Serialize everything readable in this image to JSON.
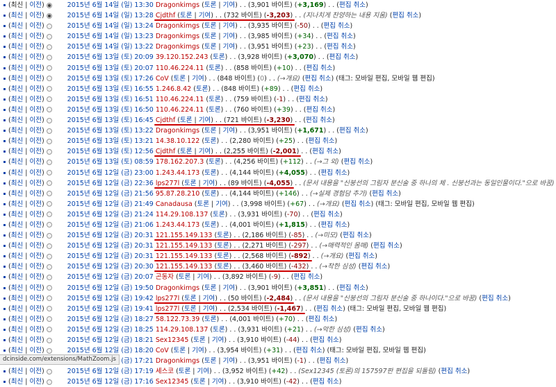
{
  "labels": {
    "cur": "최신",
    "sep": " | ",
    "prev": "이전",
    "talk": "토론",
    "contribs": "기여",
    "bytes_suffix": " 바이트",
    "undo": "편집 취소"
  },
  "rows": [
    {
      "date": "2015년 6월 14일 (일) 13:30",
      "user": "Dragonkimgs",
      "tl": true,
      "size": "3,901",
      "diff": "+3,169",
      "dc": "posbold",
      "summary": "",
      "tags": "",
      "cur_link": false,
      "prev_link": true,
      "radio": "checked",
      "underline": false
    },
    {
      "date": "2015년 6월 14일 (일) 13:28",
      "user": "Cjdthf",
      "tl": true,
      "size": "732",
      "diff": "-3,203",
      "dc": "negbold",
      "summary": "(지나치게 찬양하는 내용 지움)",
      "tags": "",
      "cur_link": true,
      "prev_link": true,
      "radio": "checked",
      "underline": true
    },
    {
      "date": "2015년 6월 14일 (일) 13:24",
      "user": "Dragonkimgs",
      "tl": true,
      "size": "3,935",
      "diff": "-50",
      "dc": "neg",
      "summary": "",
      "tags": "",
      "cur_link": true,
      "prev_link": true,
      "radio": "",
      "underline": false
    },
    {
      "date": "2015년 6월 14일 (일) 13:23",
      "user": "Dragonkimgs",
      "tl": true,
      "size": "3,985",
      "diff": "+34",
      "dc": "pos",
      "summary": "",
      "tags": "",
      "cur_link": true,
      "prev_link": true,
      "radio": "",
      "underline": false
    },
    {
      "date": "2015년 6월 14일 (일) 13:22",
      "user": "Dragonkimgs",
      "tl": true,
      "size": "3,951",
      "diff": "+23",
      "dc": "pos",
      "summary": "",
      "tags": "",
      "cur_link": true,
      "prev_link": true,
      "radio": "",
      "underline": false
    },
    {
      "date": "2015년 6월 13일 (토) 20:09",
      "user": "39.120.152.243",
      "tl": false,
      "size": "3,928",
      "diff": "+3,070",
      "dc": "posbold",
      "summary": "",
      "tags": "",
      "cur_link": true,
      "prev_link": true,
      "radio": "",
      "underline": false
    },
    {
      "date": "2015년 6월 13일 (토) 20:07",
      "user": "110.46.224.11",
      "tl": false,
      "size": "858",
      "diff": "+10",
      "dc": "pos",
      "summary": "",
      "tags": "",
      "cur_link": true,
      "prev_link": true,
      "radio": "",
      "underline": false
    },
    {
      "date": "2015년 6월 13일 (토) 17:26",
      "user": "CoV",
      "tl": true,
      "size": "848",
      "diff": "0",
      "dc": "zero",
      "summary": "(→개요)",
      "tags": "(태그: 모바일 편집, 모바일 웹 편집)",
      "cur_link": true,
      "prev_link": true,
      "radio": "",
      "underline": false
    },
    {
      "date": "2015년 6월 13일 (토) 16:55",
      "user": "1.246.8.42",
      "tl": false,
      "size": "848",
      "diff": "+89",
      "dc": "pos",
      "summary": "",
      "tags": "",
      "cur_link": true,
      "prev_link": true,
      "radio": "",
      "underline": false
    },
    {
      "date": "2015년 6월 13일 (토) 16:51",
      "user": "110.46.224.11",
      "tl": false,
      "size": "759",
      "diff": "-1",
      "dc": "neg",
      "summary": "",
      "tags": "",
      "cur_link": true,
      "prev_link": true,
      "radio": "",
      "underline": false
    },
    {
      "date": "2015년 6월 13일 (토) 16:50",
      "user": "110.46.224.11",
      "tl": false,
      "size": "760",
      "diff": "+39",
      "dc": "pos",
      "summary": "",
      "tags": "",
      "cur_link": true,
      "prev_link": true,
      "radio": "",
      "underline": false
    },
    {
      "date": "2015년 6월 13일 (토) 16:45",
      "user": "Cjdthf",
      "tl": true,
      "size": "721",
      "diff": "-3,230",
      "dc": "negbold",
      "summary": "",
      "tags": "",
      "cur_link": true,
      "prev_link": true,
      "radio": "",
      "underline": true
    },
    {
      "date": "2015년 6월 13일 (토) 13:22",
      "user": "Dragonkimgs",
      "tl": true,
      "size": "3,951",
      "diff": "+1,671",
      "dc": "posbold",
      "summary": "",
      "tags": "",
      "cur_link": true,
      "prev_link": true,
      "radio": "",
      "underline": false
    },
    {
      "date": "2015년 6월 13일 (토) 13:21",
      "user": "14.38.10.122",
      "tl": false,
      "size": "2,280",
      "diff": "+25",
      "dc": "pos",
      "summary": "",
      "tags": "",
      "cur_link": true,
      "prev_link": true,
      "radio": "",
      "underline": false
    },
    {
      "date": "2015년 6월 13일 (토) 12:56",
      "user": "Cjdthf",
      "tl": true,
      "size": "2,255",
      "diff": "-2,001",
      "dc": "negbold",
      "summary": "",
      "tags": "",
      "cur_link": true,
      "prev_link": true,
      "radio": "",
      "underline": true
    },
    {
      "date": "2015년 6월 13일 (토) 08:59",
      "user": "178.162.207.3",
      "tl": false,
      "size": "4,256",
      "diff": "+112",
      "dc": "pos",
      "summary": "(→그 외)",
      "tags": "",
      "cur_link": true,
      "prev_link": true,
      "radio": "",
      "underline": false
    },
    {
      "date": "2015년 6월 12일 (금) 23:00",
      "user": "1.243.44.173",
      "tl": false,
      "size": "4,144",
      "diff": "+4,055",
      "dc": "posbold",
      "summary": "",
      "tags": "",
      "cur_link": true,
      "prev_link": true,
      "radio": "",
      "underline": false
    },
    {
      "date": "2015년 6월 12일 (금) 22:36",
      "user": "lps277l",
      "tl": true,
      "size": "89",
      "diff": "-4,055",
      "dc": "negbold",
      "summary": "(문서 내용을 \"신붕선의 그림자 분신술 중 하나의 체 . 신붕선과는 동일인물이다.\"으로 바꿈)",
      "tags": "",
      "cur_link": true,
      "prev_link": true,
      "radio": "",
      "underline": true
    },
    {
      "date": "2015년 6월 12일 (금) 21:56",
      "user": "95.87.28.210",
      "tl": false,
      "size": "4,144",
      "diff": "+146",
      "dc": "pos",
      "summary": "(→실제 경험담 추가)",
      "tags": "",
      "cur_link": true,
      "prev_link": true,
      "radio": "",
      "underline": false
    },
    {
      "date": "2015년 6월 12일 (금) 21:49",
      "user": "Canadausa",
      "tl": true,
      "size": "3,998",
      "diff": "+67",
      "dc": "pos",
      "summary": "(→개요)",
      "tags": "(태그: 모바일 편집, 모바일 웹 편집)",
      "cur_link": true,
      "prev_link": true,
      "radio": "",
      "underline": false
    },
    {
      "date": "2015년 6월 12일 (금) 21:24",
      "user": "114.29.108.137",
      "tl": false,
      "size": "3,931",
      "diff": "-70",
      "dc": "neg",
      "summary": "",
      "tags": "",
      "cur_link": true,
      "prev_link": true,
      "radio": "",
      "underline": false
    },
    {
      "date": "2015년 6월 12일 (금) 21:06",
      "user": "1.243.44.173",
      "tl": false,
      "size": "4,001",
      "diff": "+1,815",
      "dc": "posbold",
      "summary": "",
      "tags": "",
      "cur_link": true,
      "prev_link": true,
      "radio": "",
      "underline": false
    },
    {
      "date": "2015년 6월 12일 (금) 20:31",
      "user": "121.155.149.133",
      "tl": false,
      "talk_only": true,
      "size": "2,186",
      "diff": "-85",
      "dc": "neg",
      "summary": "(→미모)",
      "tags": "",
      "cur_link": true,
      "prev_link": true,
      "radio": "",
      "underline": true
    },
    {
      "date": "2015년 6월 12일 (금) 20:31",
      "user": "121.155.149.133",
      "tl": false,
      "talk_only": true,
      "size": "2,271",
      "diff": "-297",
      "dc": "neg",
      "summary": "(→매력적인 몸매)",
      "tags": "",
      "cur_link": true,
      "prev_link": true,
      "radio": "",
      "underline": true
    },
    {
      "date": "2015년 6월 12일 (금) 20:31",
      "user": "121.155.149.133",
      "tl": false,
      "talk_only": true,
      "size": "2,568",
      "diff": "-892",
      "dc": "negbold",
      "summary": "(→개요)",
      "tags": "",
      "cur_link": true,
      "prev_link": true,
      "radio": "",
      "underline": true
    },
    {
      "date": "2015년 6월 12일 (금) 20:30",
      "user": "121.155.149.133",
      "tl": false,
      "talk_only": true,
      "size": "3,460",
      "diff": "-432",
      "dc": "neg",
      "summary": "(→착한 심성)",
      "tags": "",
      "cur_link": true,
      "prev_link": true,
      "radio": "",
      "underline": true
    },
    {
      "date": "2015년 6월 12일 (금) 20:07",
      "user": "곤동자",
      "tl": true,
      "size": "3,892",
      "diff": "-9",
      "dc": "neg",
      "summary": "",
      "tags": "",
      "cur_link": true,
      "prev_link": true,
      "radio": "",
      "underline": false
    },
    {
      "date": "2015년 6월 12일 (금) 19:50",
      "user": "Dragonkimgs",
      "tl": true,
      "size": "3,901",
      "diff": "+3,851",
      "dc": "posbold",
      "summary": "",
      "tags": "",
      "cur_link": true,
      "prev_link": true,
      "radio": "",
      "underline": false
    },
    {
      "date": "2015년 6월 12일 (금) 19:42",
      "user": "lps277l",
      "tl": true,
      "size": "50",
      "diff": "-2,484",
      "dc": "negbold",
      "summary": "(문서 내용을 \"신붕선의 그림자 분신술 중 하나이다.\"으로 바꿈)",
      "tags": "",
      "cur_link": true,
      "prev_link": true,
      "radio": "",
      "underline": true
    },
    {
      "date": "2015년 6월 12일 (금) 19:41",
      "user": "lps277l",
      "tl": true,
      "size": "2,534",
      "diff": "-1,467",
      "dc": "negbold",
      "summary": "",
      "tags": "(태그: 모바일 편집, 모바일 웹 편집)",
      "cur_link": true,
      "prev_link": true,
      "radio": "",
      "underline": true
    },
    {
      "date": "2015년 6월 12일 (금) 18:27",
      "user": "58.122.73.39",
      "tl": false,
      "size": "4,001",
      "diff": "+70",
      "dc": "pos",
      "summary": "",
      "tags": "",
      "cur_link": true,
      "prev_link": true,
      "radio": "",
      "underline": false
    },
    {
      "date": "2015년 6월 12일 (금) 18:25",
      "user": "114.29.108.137",
      "tl": false,
      "size": "3,931",
      "diff": "+21",
      "dc": "pos",
      "summary": "(→악한 심성)",
      "tags": "",
      "cur_link": true,
      "prev_link": true,
      "radio": "",
      "underline": false
    },
    {
      "date": "2015년 6월 12일 (금) 18:21",
      "user": "Sex12345",
      "tl": true,
      "size": "3,910",
      "diff": "-44",
      "dc": "neg",
      "summary": "",
      "tags": "",
      "cur_link": true,
      "prev_link": true,
      "radio": "",
      "underline": false
    },
    {
      "date": "2015년 6월 12일 (금) 18:20",
      "user": "CoV",
      "tl": true,
      "size": "3,954",
      "diff": "+31",
      "dc": "pos",
      "summary": "",
      "tags": "(태그: 모바일 편집, 모바일 웹 편집)",
      "cur_link": true,
      "prev_link": true,
      "radio": "",
      "underline": false
    },
    {
      "date": "2015년 6월 12일 (금) 17:21",
      "user": "Dragonkimgs",
      "tl": true,
      "size": "3,951",
      "diff": "-1",
      "dc": "neg",
      "summary": "",
      "tags": "",
      "cur_link": true,
      "prev_link": true,
      "radio": "",
      "underline": false
    },
    {
      "date": "2015년 6월 12일 (금) 17:19",
      "user": "세스코",
      "tl": true,
      "size": "3,952",
      "diff": "+42",
      "dc": "pos",
      "summary": "(Sex12345 (토론)의 157597판 편집을 되돌림)",
      "tags": "",
      "cur_link": true,
      "prev_link": true,
      "radio": "",
      "underline": false
    },
    {
      "date": "2015년 6월 12일 (금) 17:16",
      "user": "Sex12345",
      "tl": true,
      "size": "3,910",
      "diff": "-42",
      "dc": "neg",
      "summary": "",
      "tags": "",
      "cur_link": true,
      "prev_link": true,
      "radio": "",
      "underline": false
    }
  ],
  "status_bar": "dcinside.com/extensions/MathZoom.js"
}
